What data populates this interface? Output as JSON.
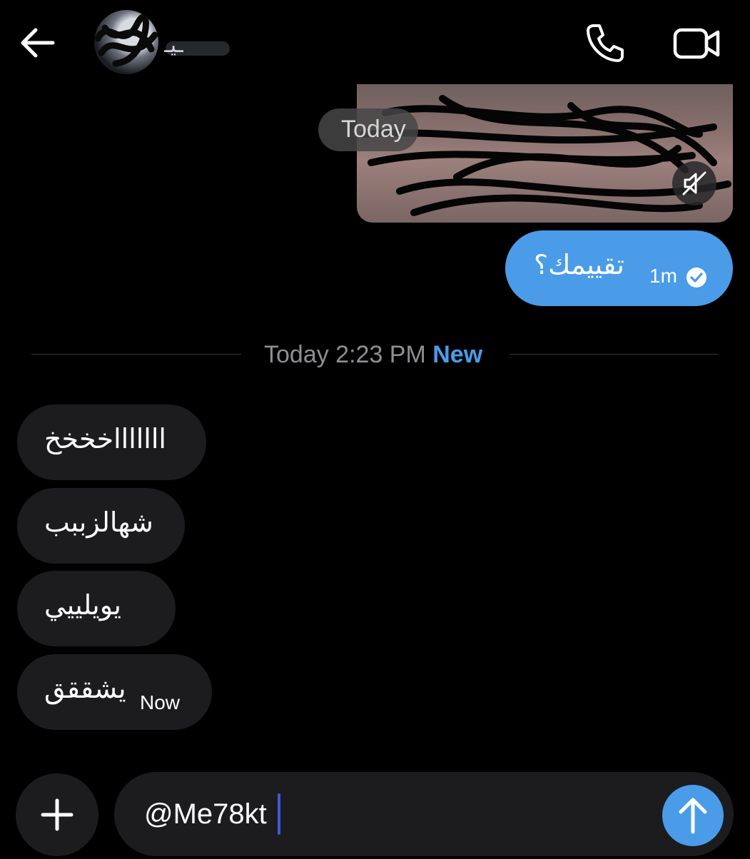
{
  "header": {
    "back_icon": "arrow-left-icon",
    "contact_name": "ـيـ",
    "call_icon": "phone-icon",
    "video_icon": "video-camera-icon"
  },
  "media": {
    "overlay_label": "Today",
    "mute_icon": "speaker-muted-icon"
  },
  "sent_message": {
    "text": "تقييمك؟",
    "time": "1m",
    "status_icon": "check-circle-icon"
  },
  "divider": {
    "time_label": "Today 2:23 PM",
    "new_label": "New"
  },
  "received_messages": [
    {
      "text": "اااااااخخخخ"
    },
    {
      "text": "شهالزببب"
    },
    {
      "text": "يويلييي"
    },
    {
      "text": "يشققق",
      "time": "Now"
    }
  ],
  "composer": {
    "plus_icon": "plus-icon",
    "input_value": "@Me78kt",
    "send_icon": "arrow-up-icon"
  },
  "colors": {
    "accent": "#4a9ce8",
    "bubble_received": "#1c1c1e",
    "background": "#000000"
  }
}
